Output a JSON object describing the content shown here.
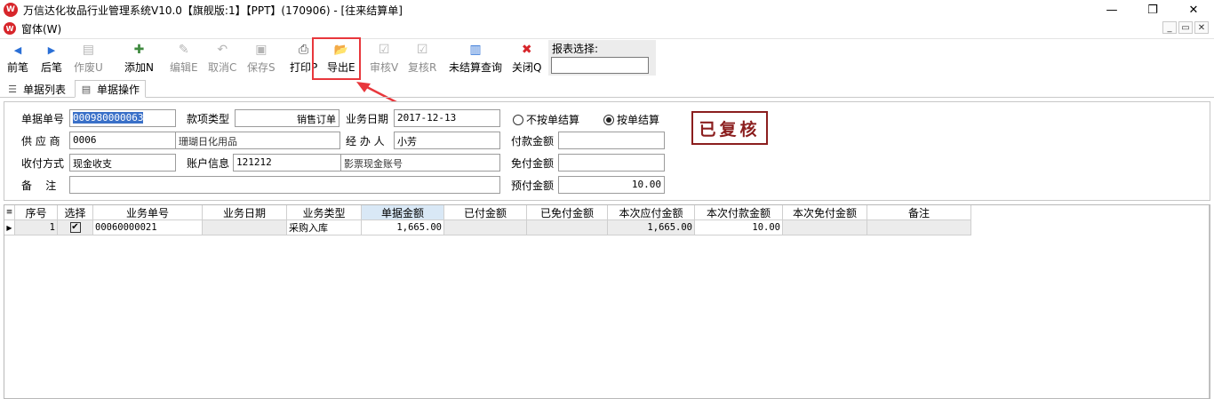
{
  "window": {
    "title": "万信达化妆品行业管理系统V10.0【旗舰版:1】【PPT】(170906) - [往来结算单]",
    "logo_text": "W",
    "menu_label": "窗体(W)",
    "controls": {
      "minimize": "—",
      "restore": "❐",
      "close": "✕"
    },
    "mdi_controls": {
      "minimize": "_",
      "restore": "▭",
      "close": "✕"
    }
  },
  "toolbar": {
    "buttons": [
      {
        "name": "prev-button",
        "label": "前笔",
        "icon": "arrow-left-icon",
        "glyph": "◀",
        "enabled": true
      },
      {
        "name": "next-button",
        "label": "后笔",
        "icon": "arrow-right-icon",
        "glyph": "▶",
        "enabled": true
      },
      {
        "name": "void-button",
        "label": "作废U",
        "icon": "void-doc-icon",
        "glyph": "▤",
        "enabled": false
      },
      {
        "name": "add-button",
        "label": "添加N",
        "icon": "add-doc-icon",
        "glyph": "✚",
        "enabled": true
      },
      {
        "name": "edit-button",
        "label": "编辑E",
        "icon": "edit-doc-icon",
        "glyph": "✎",
        "enabled": false
      },
      {
        "name": "cancel-button",
        "label": "取消C",
        "icon": "undo-icon",
        "glyph": "↶",
        "enabled": false
      },
      {
        "name": "save-button",
        "label": "保存S",
        "icon": "save-icon",
        "glyph": "▣",
        "enabled": false
      },
      {
        "name": "print-button",
        "label": "打印P",
        "icon": "printer-icon",
        "glyph": "⎙",
        "enabled": true
      },
      {
        "name": "export-button",
        "label": "导出E",
        "icon": "export-folder-icon",
        "glyph": "📂",
        "enabled": true
      },
      {
        "name": "review-button",
        "label": "审核V",
        "icon": "approve-icon",
        "glyph": "☑",
        "enabled": false
      },
      {
        "name": "recheck-button",
        "label": "复核R",
        "icon": "recheck-icon",
        "glyph": "☑",
        "enabled": false
      },
      {
        "name": "unsettled-query-button",
        "label": "未结算查询",
        "icon": "bar-chart-icon",
        "glyph": "▥",
        "enabled": true
      },
      {
        "name": "close-button",
        "label": "关闭Q",
        "icon": "close-x-icon",
        "glyph": "✖",
        "enabled": true
      }
    ],
    "report_select_label": "报表选择:",
    "report_select_value": ""
  },
  "tabs": [
    {
      "label": "单据列表",
      "icon": "list-icon",
      "active": false
    },
    {
      "label": "单据操作",
      "icon": "form-icon",
      "active": true
    }
  ],
  "form": {
    "doc_no_label": "单据单号",
    "doc_no": "000980000063",
    "item_type_label": "款项类型",
    "item_type": "销售订单",
    "biz_date_label": "业务日期",
    "biz_date": "2017-12-13",
    "radio_no_doc": "不按单结算",
    "radio_by_doc": "按单结算",
    "supplier_label": "供 应 商",
    "supplier_code": "0006",
    "supplier_name": "珊瑚日化用品",
    "handler_label": "经 办 人",
    "handler": "小芳",
    "pay_amount_label": "付款金额",
    "pay_amount": "",
    "pay_method_label": "收付方式",
    "pay_method": "现金收支",
    "account_label": "账户信息",
    "account_code": "121212",
    "account_name": "影票现金账号",
    "free_amount_label": "免付金额",
    "free_amount": "",
    "remark_label": "备    注",
    "remark": "",
    "prepay_label": "预付金额",
    "prepay_amount": "10.00",
    "status_stamp": "已复核"
  },
  "grid": {
    "row_indicator": "≡",
    "columns": [
      "序号",
      "选择",
      "业务单号",
      "业务日期",
      "业务类型",
      "单据金额",
      "已付金额",
      "已免付金额",
      "本次应付金额",
      "本次付款金额",
      "本次免付金额",
      "备注"
    ],
    "rows": [
      {
        "marker": "▶",
        "seq": "1",
        "checked": true,
        "check_glyph": "✔",
        "biz_no": "00060000021",
        "biz_date": "",
        "biz_type": "采购入库",
        "doc_amount": "1,665.00",
        "paid": "",
        "free_paid": "",
        "due_now": "1,665.00",
        "pay_now": "10.00",
        "free_now": "",
        "remark": ""
      }
    ]
  }
}
